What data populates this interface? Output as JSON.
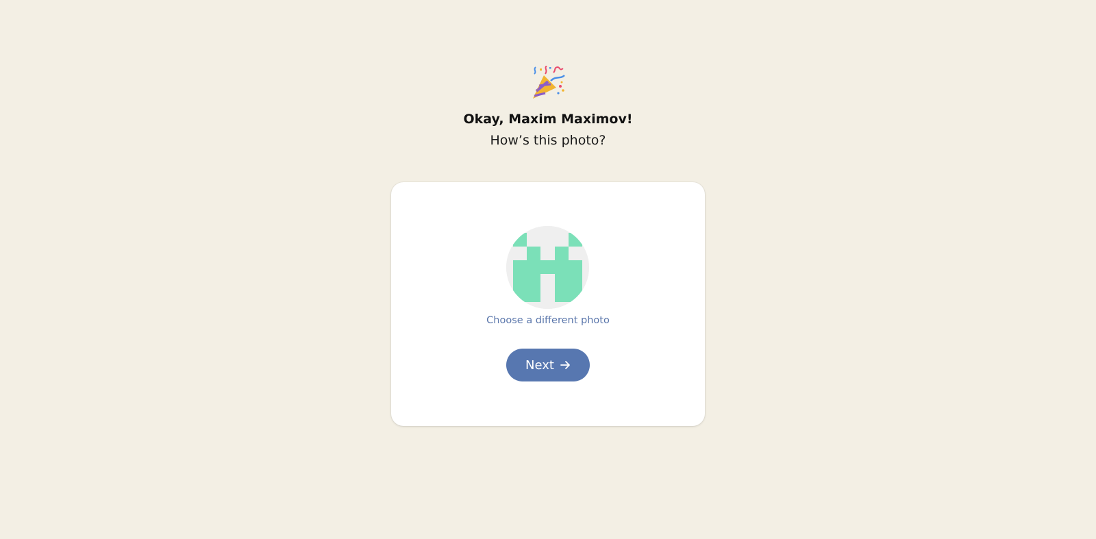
{
  "header": {
    "emoji_icon": "party-popper-icon",
    "title": "Okay, Maxim Maximov!",
    "subtitle": "How’s this photo?"
  },
  "card": {
    "avatar_icon": "identicon-avatar",
    "avatar_color": "#7be0b8",
    "avatar_bg": "#efefef",
    "change_photo_label": "Choose a different photo",
    "next_label": "Next",
    "next_icon": "arrow-right-icon",
    "accent_color": "#5777b0"
  }
}
